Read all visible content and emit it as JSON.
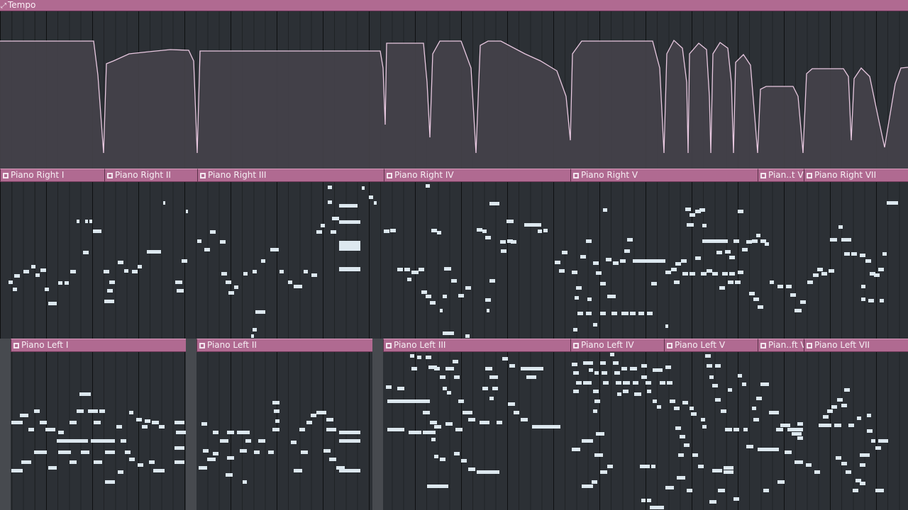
{
  "tempo": {
    "label": "Tempo",
    "icon": "automation-icon",
    "curve_color": "#e8c8e0",
    "fill_color": "#44424a"
  },
  "colors": {
    "clip_header": "#b06a91",
    "note": "#dde8ef",
    "background": "#2c3035"
  },
  "right_clips": [
    {
      "name": "Piano Right I"
    },
    {
      "name": "Piano Right II"
    },
    {
      "name": "Piano Right III"
    },
    {
      "name": "Piano Right IV"
    },
    {
      "name": "Piano Right V"
    },
    {
      "name": "Pian..t VI"
    },
    {
      "name": "Piano Right VII"
    }
  ],
  "left_clips": [
    {
      "name": "Piano Left I"
    },
    {
      "name": "Piano Left II"
    },
    {
      "name": "Piano Left III"
    },
    {
      "name": "Piano Left IV"
    },
    {
      "name": "Piano Left V"
    },
    {
      "name": "Pian..ft VI"
    },
    {
      "name": "Piano Left VII"
    }
  ]
}
